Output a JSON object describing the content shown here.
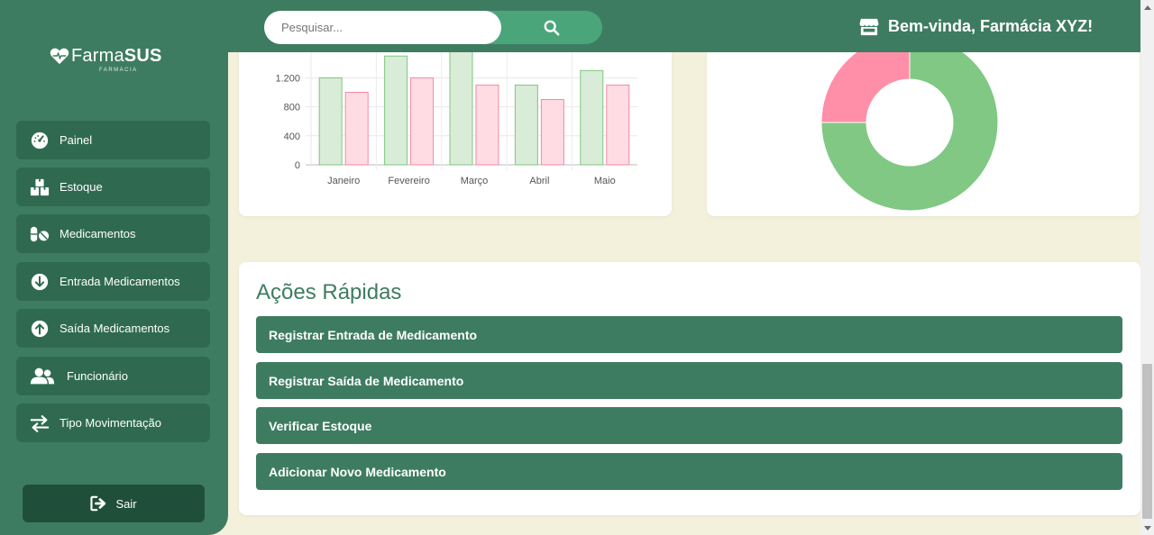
{
  "brand": {
    "name_light": "Farma",
    "name_bold": "SUS",
    "subtitle": "FARMÁCIA"
  },
  "search": {
    "placeholder": "Pesquisar..."
  },
  "header": {
    "welcome": "Bem-vinda, Farmácia XYZ!"
  },
  "sidebar": {
    "items": [
      {
        "label": "Painel",
        "icon": "dashboard-gauge-icon"
      },
      {
        "label": "Estoque",
        "icon": "boxes-icon"
      },
      {
        "label": "Medicamentos",
        "icon": "pills-icon"
      },
      {
        "label": "Entrada Medicamentos",
        "icon": "arrow-circle-down-icon"
      },
      {
        "label": "Saída Medicamentos",
        "icon": "arrow-circle-up-icon"
      },
      {
        "label": "Funcionário",
        "icon": "users-icon"
      },
      {
        "label": "Tipo Movimentação",
        "icon": "exchange-arrows-icon"
      }
    ],
    "logout_label": "Sair"
  },
  "actions": {
    "title": "Ações Rápidas",
    "buttons": [
      "Registrar Entrada de Medicamento",
      "Registrar Saída de Medicamento",
      "Verificar Estoque",
      "Adicionar Novo Medicamento"
    ]
  },
  "colors": {
    "primary": "#3e7c61",
    "sidebar_item": "#2f6a50",
    "logout": "#1f4f3b",
    "search_button": "#4aa67a",
    "page_bg": "#f3f1dc",
    "bar_green_fill": "#d8ecd8",
    "bar_green_stroke": "#7fc77f",
    "bar_pink_fill": "#ffdce3",
    "bar_pink_stroke": "#f28aa3",
    "donut_green": "#80c883",
    "donut_pink": "#ff8fa8"
  },
  "chart_data": [
    {
      "type": "bar",
      "categories": [
        "Janeiro",
        "Fevereiro",
        "Março",
        "Abril",
        "Maio"
      ],
      "series": [
        {
          "values": [
            1200,
            1500,
            1600,
            1100,
            1300
          ]
        },
        {
          "values": [
            1000,
            1200,
            1100,
            900,
            1100
          ]
        }
      ],
      "yticks": [
        "0",
        "400",
        "800",
        "1.200"
      ],
      "ylim": [
        0,
        1600
      ],
      "title": "",
      "xlabel": "",
      "ylabel": ""
    },
    {
      "type": "pie",
      "donut": true,
      "slices": [
        {
          "value": 75,
          "color": "#80c883"
        },
        {
          "value": 25,
          "color": "#ff8fa8"
        }
      ]
    }
  ]
}
